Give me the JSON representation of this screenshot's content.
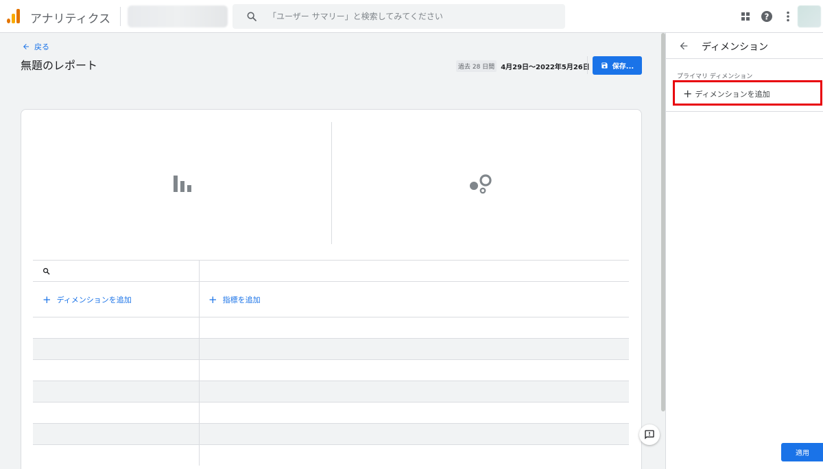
{
  "header": {
    "app_title": "アナリティクス",
    "search_placeholder": "「ユーザー サマリー」と検索してみてください"
  },
  "main": {
    "back_label": "戻る",
    "page_title": "無題のレポート",
    "date_chip": "過去 28 日間",
    "date_range": "4月29日～2022年5月26日",
    "save_label": "保存..."
  },
  "table": {
    "add_dimension_label": "ディメンションを追加",
    "add_metric_label": "指標を追加",
    "empty_rows": 7
  },
  "panel": {
    "title": "ディメンション",
    "section_label": "プライマリ ディメンション",
    "add_dimension_label": "ディメンションを追加",
    "apply_label": "適用"
  },
  "colors": {
    "accent": "#1a73e8",
    "highlight": "#e8000b",
    "logo_orange": "#e37400",
    "logo_yellow": "#f9ab00"
  },
  "icons": [
    "analytics-logo-icon",
    "search-icon",
    "apps-grid-icon",
    "help-icon",
    "more-vert-icon",
    "arrow-back-icon",
    "save-icon",
    "bar-chart-icon",
    "bubble-chart-icon",
    "plus-icon",
    "feedback-icon"
  ]
}
